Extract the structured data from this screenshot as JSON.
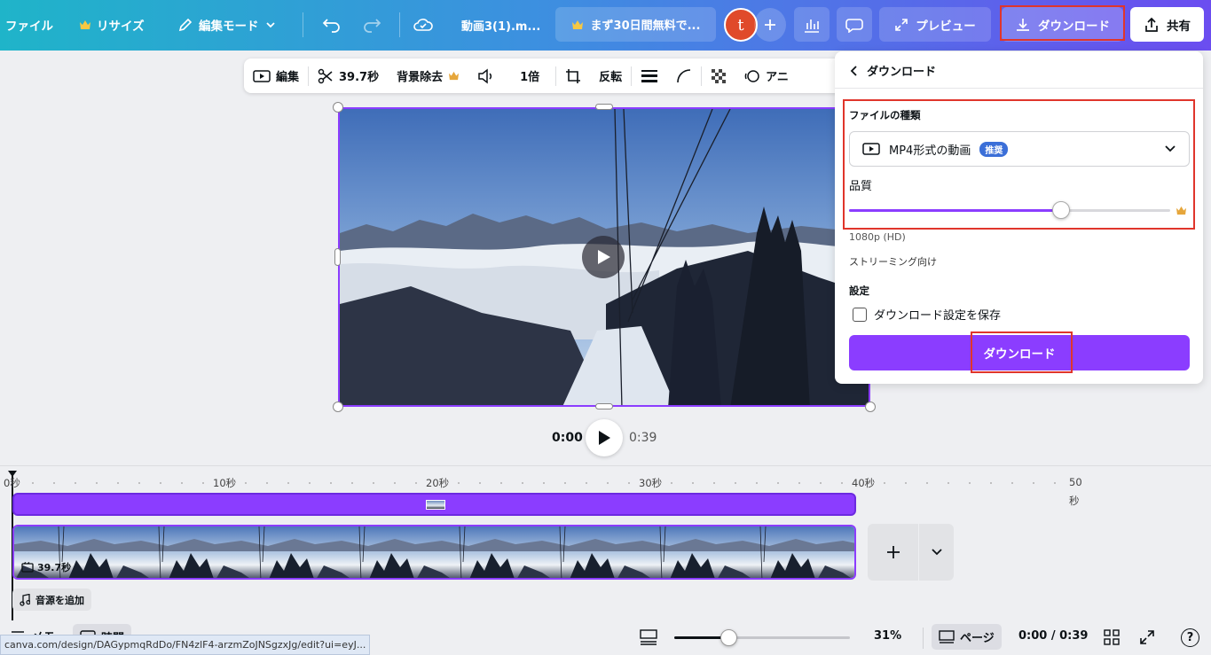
{
  "topbar": {
    "file": "ファイル",
    "resize": "リサイズ",
    "edit_mode": "編集モード",
    "doc_title": "動画3(1).m...",
    "trial": "まず30日間無料で...",
    "avatar_letter": "t",
    "preview": "プレビュー",
    "download": "ダウンロード",
    "share": "共有"
  },
  "context_toolbar": {
    "edit": "編集",
    "duration": "39.7秒",
    "bg_remove": "背景除去",
    "speed": "1倍",
    "flip": "反転",
    "animate": "アニ"
  },
  "player": {
    "current": "0:00",
    "total": "0:39"
  },
  "download_panel": {
    "title": "ダウンロード",
    "file_type_label": "ファイルの種類",
    "file_type_value": "MP4形式の動画",
    "recommended_badge": "推奨",
    "quality_label": "品質",
    "quality_level": 0.66,
    "quality_value": "1080p (HD)",
    "streaming": "ストリーミング向け",
    "settings_label": "設定",
    "save_settings": "ダウンロード設定を保存",
    "download_button": "ダウンロード"
  },
  "timeline": {
    "ticks": [
      "0秒",
      "10秒",
      "20秒",
      "30秒",
      "40秒",
      "50",
      "秒"
    ],
    "clip_duration": "39.7秒",
    "add_audio": "音源を追加"
  },
  "bottom": {
    "notes": "メモ",
    "timing": "時間",
    "zoom": "31%",
    "zoom_level": 0.31,
    "pages": "ページ",
    "time": "0:00 / 0:39"
  },
  "status_url": "canva.com/design/DAGypmqRdDo/FN4zlF4-arzmZoJNSgzxJg/edit?ui=eyJ...",
  "colors": {
    "accent": "#8b3dff",
    "highlight": "#e0352b"
  }
}
